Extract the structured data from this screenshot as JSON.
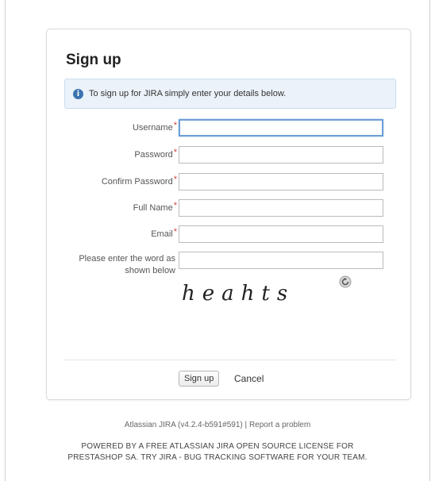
{
  "page": {
    "title": "Sign up",
    "info_message": "To sign up for JIRA simply enter your details below."
  },
  "form": {
    "fields": [
      {
        "label": "Username",
        "required": true,
        "value": ""
      },
      {
        "label": "Password",
        "required": true,
        "value": ""
      },
      {
        "label": "Confirm Password",
        "required": true,
        "value": ""
      },
      {
        "label": "Full Name",
        "required": true,
        "value": ""
      },
      {
        "label": "Email",
        "required": true,
        "value": ""
      }
    ],
    "captcha": {
      "label": "Please enter the word as shown below",
      "value": "",
      "word": "heahts"
    },
    "required_marker": "*",
    "submit_label": "Sign up",
    "cancel_label": "Cancel"
  },
  "footer": {
    "version": "Atlassian JIRA (v4.2.4-b591#591)",
    "separator": "|",
    "report_link": "Report a problem",
    "powered_line1": "POWERED BY A FREE ATLASSIAN JIRA OPEN SOURCE LICENSE FOR",
    "powered_line2": "PRESTASHOP SA. TRY JIRA - BUG TRACKING SOFTWARE FOR YOUR TEAM."
  },
  "colors": {
    "info_bg": "#ebf2f9",
    "info_icon": "#3b73af",
    "required": "#d04437",
    "focus_border": "#6d9fd6"
  },
  "icons": {
    "info": "info-circle-icon",
    "refresh": "refresh-icon"
  }
}
